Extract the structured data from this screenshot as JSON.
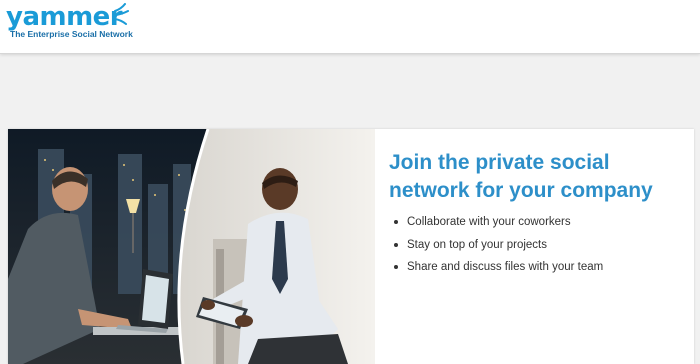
{
  "header": {
    "logo_text": "yammer",
    "tagline": "The Enterprise Social Network"
  },
  "hero": {
    "headline": "Join the private social network for your company",
    "features": [
      "Collaborate with your coworkers",
      "Stay on top of your projects",
      "Share and discuss files with your team"
    ],
    "image_icon": "office-workers-photo"
  },
  "colors": {
    "brand_blue": "#1a9bd7",
    "headline_blue": "#2d8fc9",
    "page_background": "#f1f1f1"
  }
}
